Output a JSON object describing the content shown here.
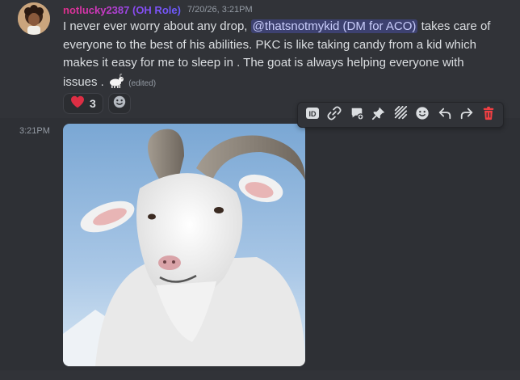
{
  "message": {
    "username": "notlucky2387 (OH Role)",
    "timestamp": "7/20/26, 3:21PM",
    "text_before_mention": "I never ever worry about any drop, ",
    "mention": "@thatsnotmykid (DM for ACO)",
    "text_after_mention": " takes care of everyone to the best of his abilities. PKC is like taking candy from a kid which makes it easy for me to sleep in . The goat is always helping everyone with issues . ",
    "edited_label": "(edited)",
    "reactions": [
      {
        "emoji": "heart",
        "count": "3"
      }
    ]
  },
  "toolbar": {
    "icons": [
      "id-icon",
      "link-icon",
      "thread-icon",
      "pin-icon",
      "mark-unread-icon",
      "emoji-icon",
      "reply-icon",
      "forward-icon",
      "delete-icon"
    ]
  },
  "attachment_message": {
    "timestamp": "3:21PM"
  },
  "colors": {
    "background": "#313338",
    "hover_background": "#2e3035",
    "mention_text": "#c9cdfb",
    "delete_red": "#f23f43",
    "heart_red": "#dd2e44"
  }
}
